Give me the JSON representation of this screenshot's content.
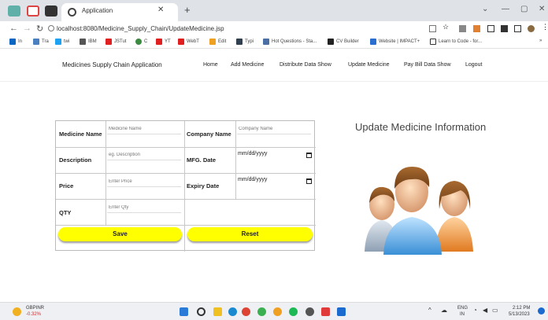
{
  "browser": {
    "tab_title": "Application",
    "url": "localhost:8080/Medicine_Supply_Chain/UpdateMedicine.jsp",
    "bookmarks": [
      "In",
      "Tra",
      "twi",
      "IBM",
      "JSTut",
      "C",
      "YT",
      "WebT",
      "Edit",
      "Typi",
      "Hot Questions - Sta...",
      "CV Builder",
      "Website | IMPACT+",
      "Learn to Code - for..."
    ]
  },
  "app": {
    "brand": "Medicines Supply Chain Application",
    "nav": [
      "Home",
      "Add Medicine",
      "Distribute Data Show",
      "Update Medicine",
      "Pay Bill Data Show",
      "Logout"
    ]
  },
  "form": {
    "medicine_name_label": "Medicine Name",
    "medicine_name_placeholder": "Medicine Name",
    "company_name_label": "Company Name",
    "company_name_placeholder": "Company Name",
    "description_label": "Description",
    "description_placeholder": "eg. Description",
    "mfg_date_label": "MFG. Date",
    "mfg_date_value": "mm/dd/yyyy",
    "price_label": "Price",
    "price_placeholder": "Enter Price",
    "expiry_date_label": "Expiry Date",
    "expiry_date_value": "mm/dd/yyyy",
    "qty_label": "QTY",
    "qty_placeholder": "Enter Qty",
    "save_label": "Save",
    "reset_label": "Reset"
  },
  "heading": "Update Medicine Information",
  "taskbar": {
    "ticker_name": "GBPINR",
    "ticker_change": "-0.32%",
    "lang": "ENG",
    "region": "IN",
    "time": "2:12 PM",
    "date": "5/13/2023"
  },
  "colors": {
    "button_yellow": "#ffff00",
    "ticker_negative": "#d03030"
  }
}
